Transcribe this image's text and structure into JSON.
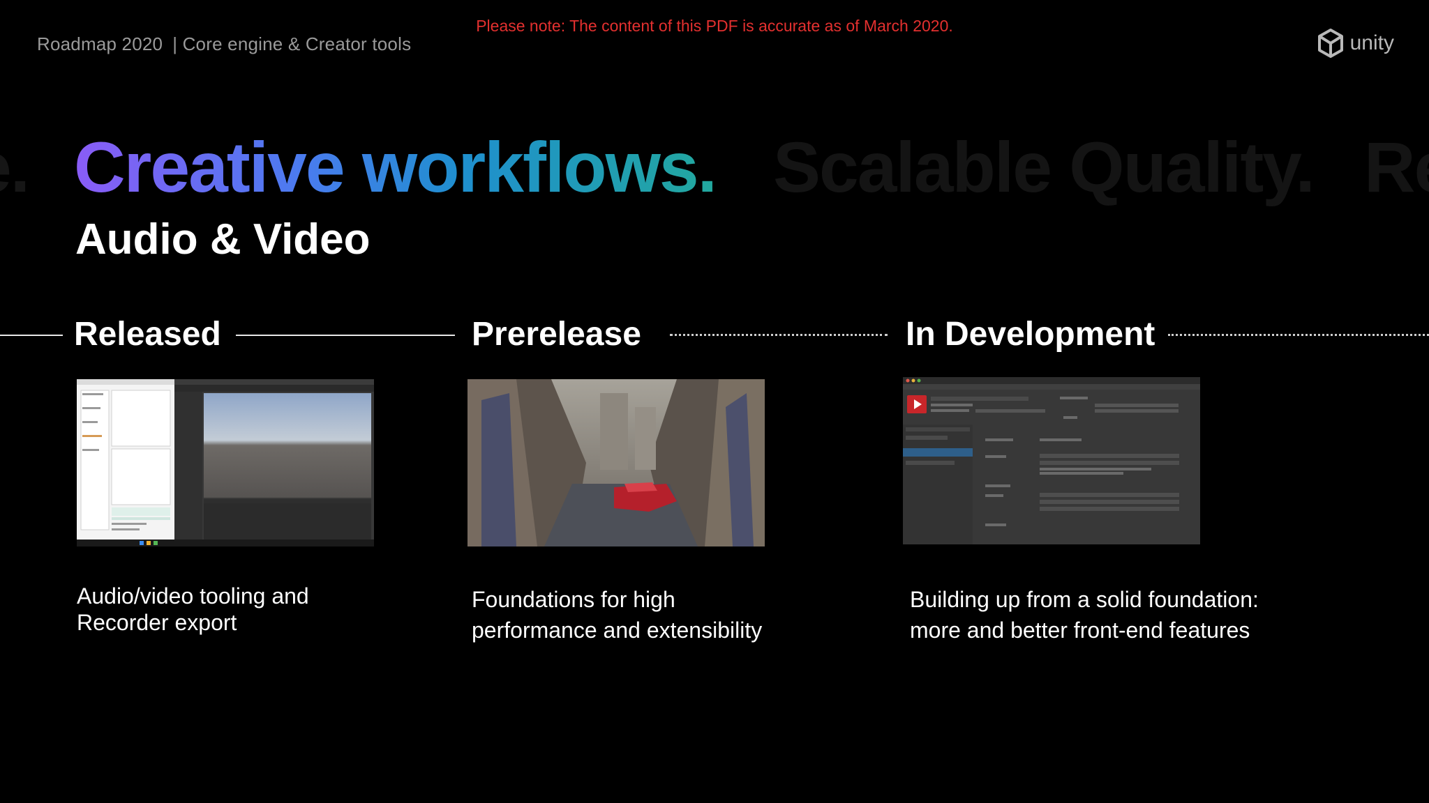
{
  "header": {
    "roadmap": "Roadmap 2020",
    "section": "| Core engine & Creator tools",
    "notice": "Please note: The content of this PDF is accurate as of March 2020.",
    "logo_text": "unity"
  },
  "title": {
    "prev_fragment": "e.",
    "main": "Creative workflows.",
    "next": "Scalable Quality.",
    "next_fragment": "Re"
  },
  "subtitle": "Audio & Video",
  "stages": [
    {
      "label": "Released",
      "caption_lines": [
        "Audio/video tooling and",
        "Recorder export"
      ]
    },
    {
      "label": "Prerelease",
      "caption_lines": [
        "Foundations for high",
        "performance and extensibility"
      ]
    },
    {
      "label": "In Development",
      "caption_lines": [
        "Building up from a solid foundation:",
        "more and better front-end features"
      ]
    }
  ],
  "colors": {
    "background": "#000000",
    "notice": "#e3302f",
    "gradient_start": "#8a5cf6",
    "gradient_end": "#22a89e"
  },
  "icons": {
    "logo": "unity-cube-icon"
  }
}
